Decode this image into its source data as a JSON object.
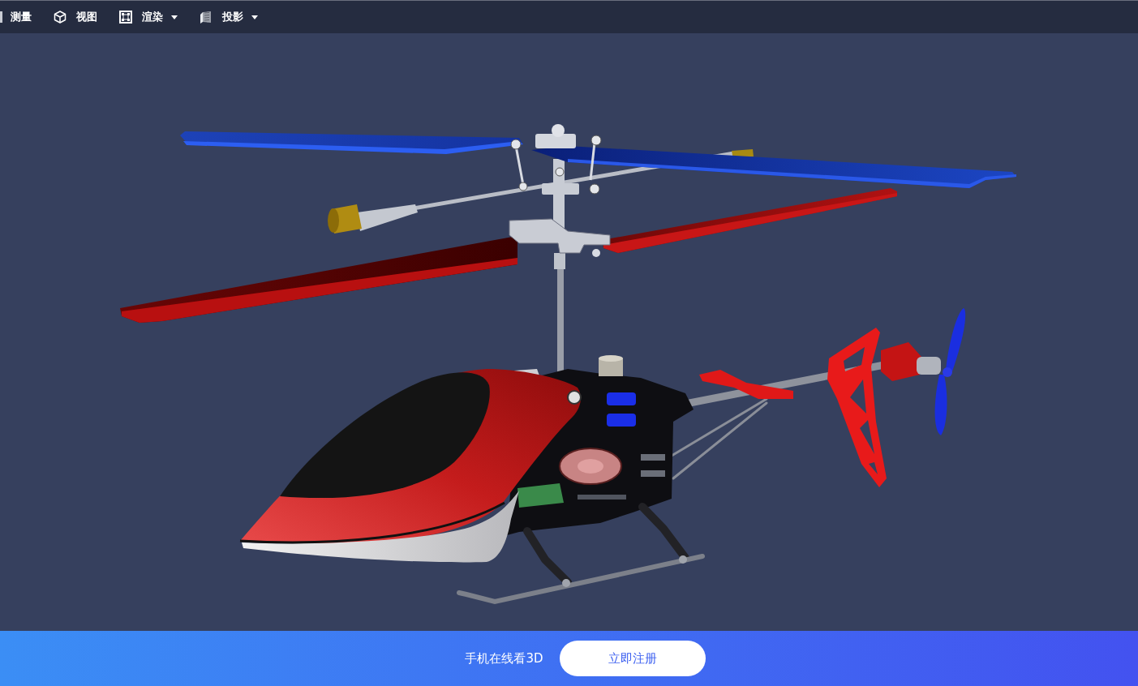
{
  "toolbar": {
    "items": [
      {
        "label": "测量",
        "kind": "button"
      },
      {
        "label": "视图",
        "kind": "button"
      },
      {
        "label": "渲染",
        "kind": "dropdown"
      },
      {
        "label": "投影",
        "kind": "dropdown"
      }
    ]
  },
  "footer_banner": {
    "text": "手机在线看3D",
    "button": "立即注册"
  }
}
